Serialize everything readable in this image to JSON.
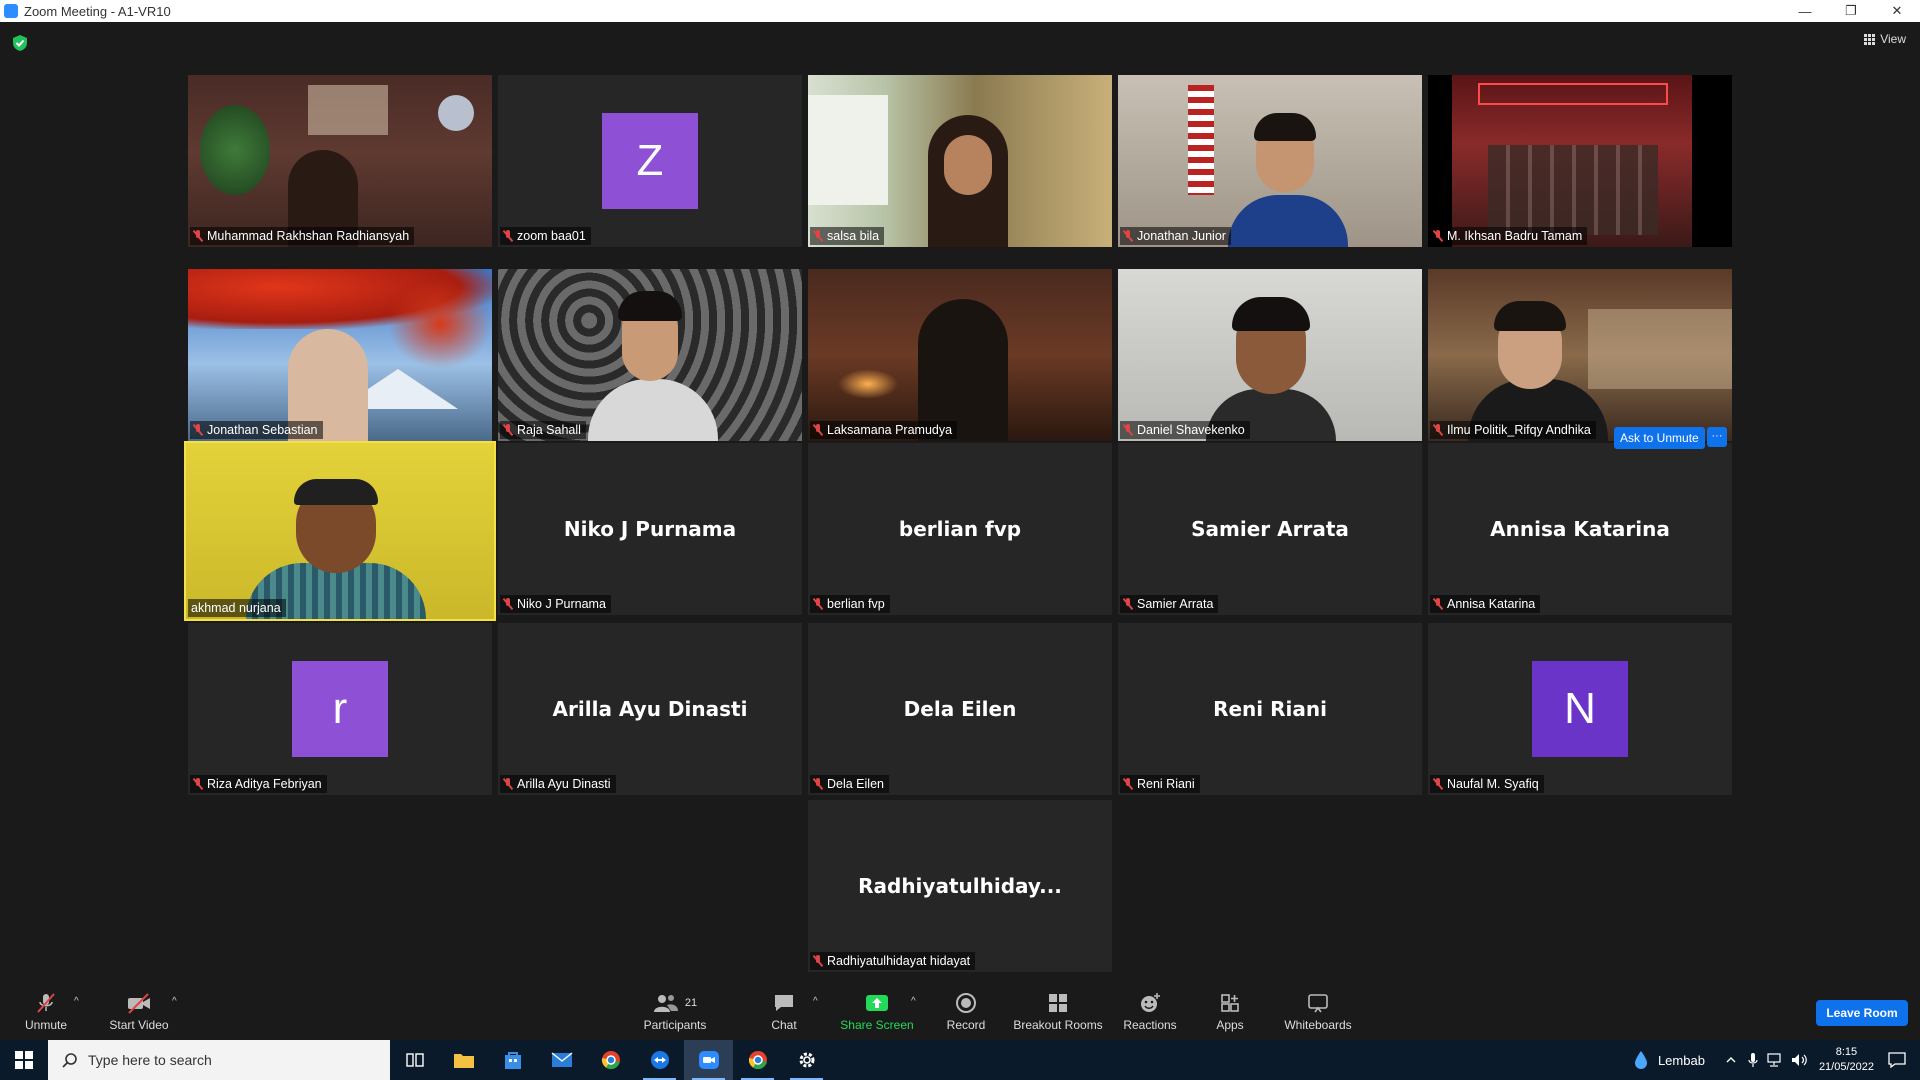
{
  "window": {
    "title": "Zoom Meeting - A1-VR10",
    "minimize": "—",
    "restore": "❐",
    "close": "✕"
  },
  "view_label": "View",
  "participants": [
    {
      "name": "Muhammad Rakhshan Radhiansyah"
    },
    {
      "name": "zoom baa01",
      "avatar_letter": "Z",
      "avatar_color": "#8e51d6"
    },
    {
      "name": "salsa bila"
    },
    {
      "name": "Jonathan Junior"
    },
    {
      "name": "M. Ikhsan Badru Tamam"
    },
    {
      "name": "Jonathan Sebastian"
    },
    {
      "name": "Raja Sahall"
    },
    {
      "name": "Laksamana Pramudya"
    },
    {
      "name": "Daniel Shavekenko"
    },
    {
      "name": "Ilmu Politik_Rifqy Andhika"
    },
    {
      "name": "akhmad nurjana"
    },
    {
      "name": "Niko J Purnama",
      "display": "Niko J Purnama"
    },
    {
      "name": "berlian fvp",
      "display": "berlian fvp"
    },
    {
      "name": "Samier Arrata",
      "display": "Samier Arrata"
    },
    {
      "name": "Annisa Katarina",
      "display": "Annisa Katarina"
    },
    {
      "name": "Riza Aditya Febriyan",
      "avatar_letter": "r",
      "avatar_color": "#8e51d6"
    },
    {
      "name": "Arilla Ayu Dinasti",
      "display": "Arilla Ayu Dinasti"
    },
    {
      "name": "Dela Eilen",
      "display": "Dela Eilen"
    },
    {
      "name": "Reni Riani",
      "display": "Reni Riani"
    },
    {
      "name": "Naufal M. Syafiq",
      "avatar_letter": "N",
      "avatar_color": "#6b34c9"
    },
    {
      "name": "Radhiyatulhidayat hidayat",
      "display": "Radhiyatulhiday..."
    }
  ],
  "ask_to_unmute": "Ask to Unmute",
  "more": "···",
  "controls": {
    "unmute": "Unmute",
    "start_video": "Start Video",
    "participants": "Participants",
    "participants_count": "21",
    "chat": "Chat",
    "share_screen": "Share Screen",
    "record": "Record",
    "breakout_rooms": "Breakout Rooms",
    "reactions": "Reactions",
    "apps": "Apps",
    "whiteboards": "Whiteboards",
    "leave": "Leave Room",
    "caret": "^"
  },
  "taskbar": {
    "search_placeholder": "Type here to search",
    "weather": "Lembab",
    "time": "8:15",
    "date": "21/05/2022"
  }
}
